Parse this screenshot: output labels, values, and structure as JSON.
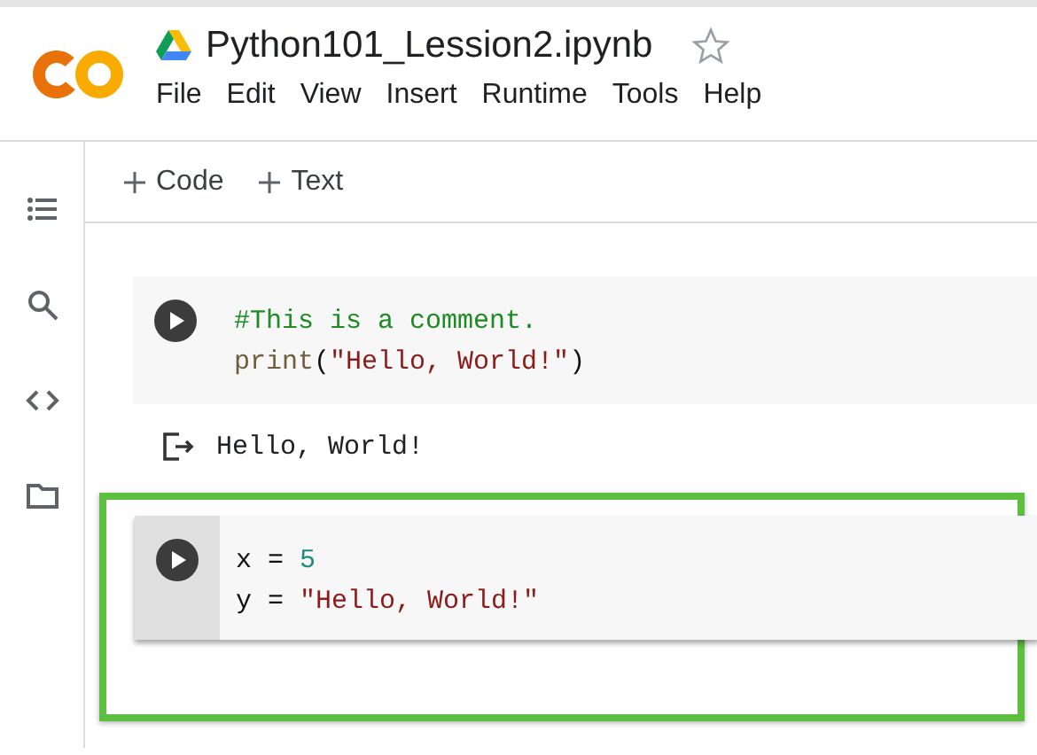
{
  "header": {
    "title": "Python101_Lession2.ipynb",
    "starred": false,
    "menu": [
      "File",
      "Edit",
      "View",
      "Insert",
      "Runtime",
      "Tools",
      "Help"
    ]
  },
  "toolbar": [
    {
      "label": "Code"
    },
    {
      "label": "Text"
    }
  ],
  "sidebar": [
    {
      "kind": "toc"
    },
    {
      "kind": "search"
    },
    {
      "kind": "code"
    },
    {
      "kind": "files"
    }
  ],
  "cells": [
    {
      "kind": "code",
      "selected": false,
      "highlighted": false,
      "lines": [
        [
          {
            "text": "#This is a comment.",
            "kind": "comment"
          }
        ],
        [
          {
            "text": "print",
            "kind": "func"
          },
          {
            "text": "(",
            "kind": "plain"
          },
          {
            "text": "\"Hello, World!\"",
            "kind": "string"
          },
          {
            "text": ")",
            "kind": "plain"
          }
        ]
      ]
    },
    {
      "kind": "output",
      "text": "Hello, World!"
    },
    {
      "kind": "code",
      "selected": true,
      "highlighted": true,
      "lines": [
        [
          {
            "text": "x = ",
            "kind": "plain"
          },
          {
            "text": "5",
            "kind": "number"
          }
        ],
        [
          {
            "text": "y = ",
            "kind": "plain"
          },
          {
            "text": "\"Hello, World!\"",
            "kind": "string"
          }
        ]
      ]
    }
  ]
}
